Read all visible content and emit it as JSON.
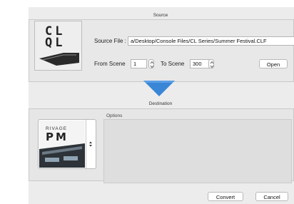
{
  "source": {
    "section_title": "Source",
    "logo_lines": [
      "CL",
      "QL"
    ],
    "file_label": "Source File :",
    "file_path": "a/Desktop/Console Files/CL Series/Summer Festival.CLF",
    "from_label": "From Scene",
    "from_value": "1",
    "to_label": "To Scene",
    "to_value": "300",
    "open_label": "Open"
  },
  "destination": {
    "section_title": "Destination",
    "console_lines": [
      "RIVAGE",
      "PM"
    ],
    "options_label": "Options"
  },
  "footer": {
    "convert_label": "Convert",
    "cancel_label": "Cancel"
  },
  "colors": {
    "arrow": "#3a86d6",
    "dialog_bg": "#ececec"
  }
}
